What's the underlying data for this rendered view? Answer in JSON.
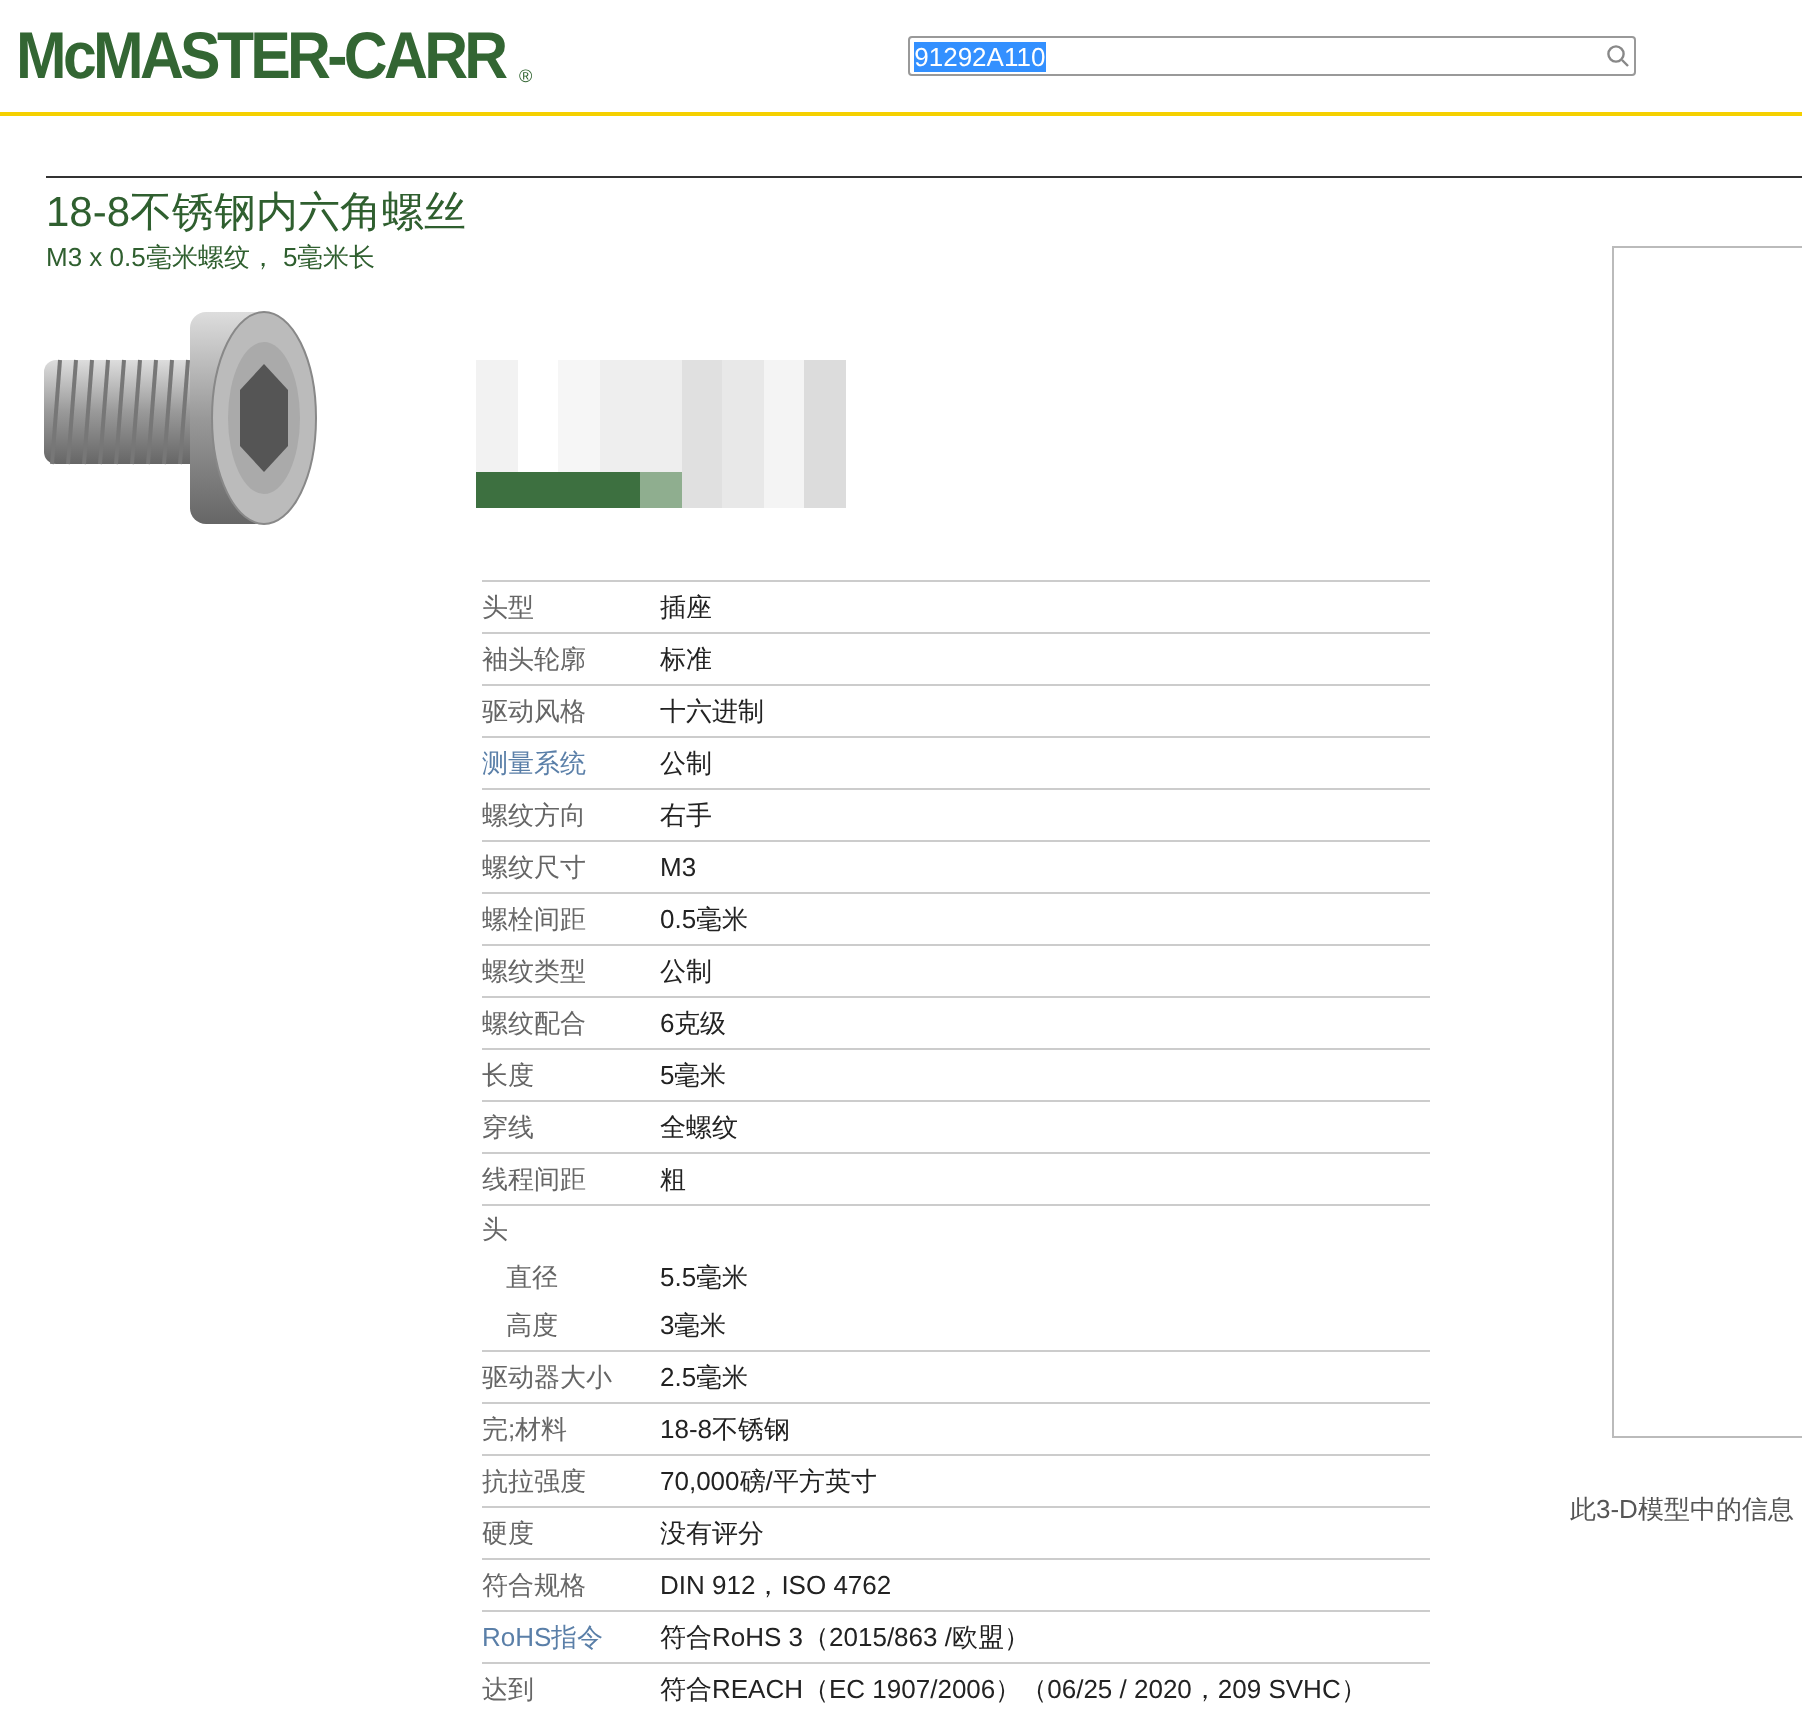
{
  "header": {
    "logo": "McMASTER-CARR",
    "logo_mark": "®",
    "search": {
      "value": "91292A110",
      "selected_text": true
    }
  },
  "product": {
    "title": "18-8不锈钢内六角螺丝",
    "subtitle": "M3 x 0.5毫米螺纹， 5毫米长"
  },
  "specs": [
    {
      "label": "头型",
      "value": "插座",
      "kind": "plain"
    },
    {
      "label": "袖头轮廓",
      "value": "标准",
      "kind": "plain"
    },
    {
      "label": "驱动风格",
      "value": "十六进制",
      "kind": "plain"
    },
    {
      "label": "测量系统",
      "value": "公制",
      "kind": "link"
    },
    {
      "label": "螺纹方向",
      "value": "右手",
      "kind": "plain"
    },
    {
      "label": "螺纹尺寸",
      "value": "M3",
      "kind": "plain"
    },
    {
      "label": "螺栓间距",
      "value": "0.5毫米",
      "kind": "plain"
    },
    {
      "label": "螺纹类型",
      "value": "公制",
      "kind": "plain"
    },
    {
      "label": "螺纹配合",
      "value": "6克级",
      "kind": "plain"
    },
    {
      "label": "长度",
      "value": "5毫米",
      "kind": "plain"
    },
    {
      "label": "穿线",
      "value": "全螺纹",
      "kind": "plain"
    },
    {
      "label": "线程间距",
      "value": "粗",
      "kind": "plain"
    },
    {
      "label": "头",
      "kind": "group",
      "children": [
        {
          "label": "直径",
          "value": "5.5毫米"
        },
        {
          "label": "高度",
          "value": "3毫米"
        }
      ]
    },
    {
      "label": "驱动器大小",
      "value": "2.5毫米",
      "kind": "plain"
    },
    {
      "label": "完;材料",
      "value": "18-8不锈钢",
      "kind": "plain"
    },
    {
      "label": "抗拉强度",
      "value": "70,000磅/平方英寸",
      "kind": "plain"
    },
    {
      "label": "硬度",
      "value": "没有评分",
      "kind": "plain"
    },
    {
      "label": "符合规格",
      "value": "DIN 912，ISO 4762",
      "kind": "plain"
    },
    {
      "label": "RoHS指令",
      "value": "符合RoHS 3（2015/863 /欧盟）",
      "kind": "link"
    },
    {
      "label": "达到",
      "value": "符合REACH（EC 1907/2006）（06/25 / 2020，209 SVHC）",
      "kind": "plain"
    }
  ],
  "model_panel": {
    "caption": "此3-D模型中的信息"
  }
}
